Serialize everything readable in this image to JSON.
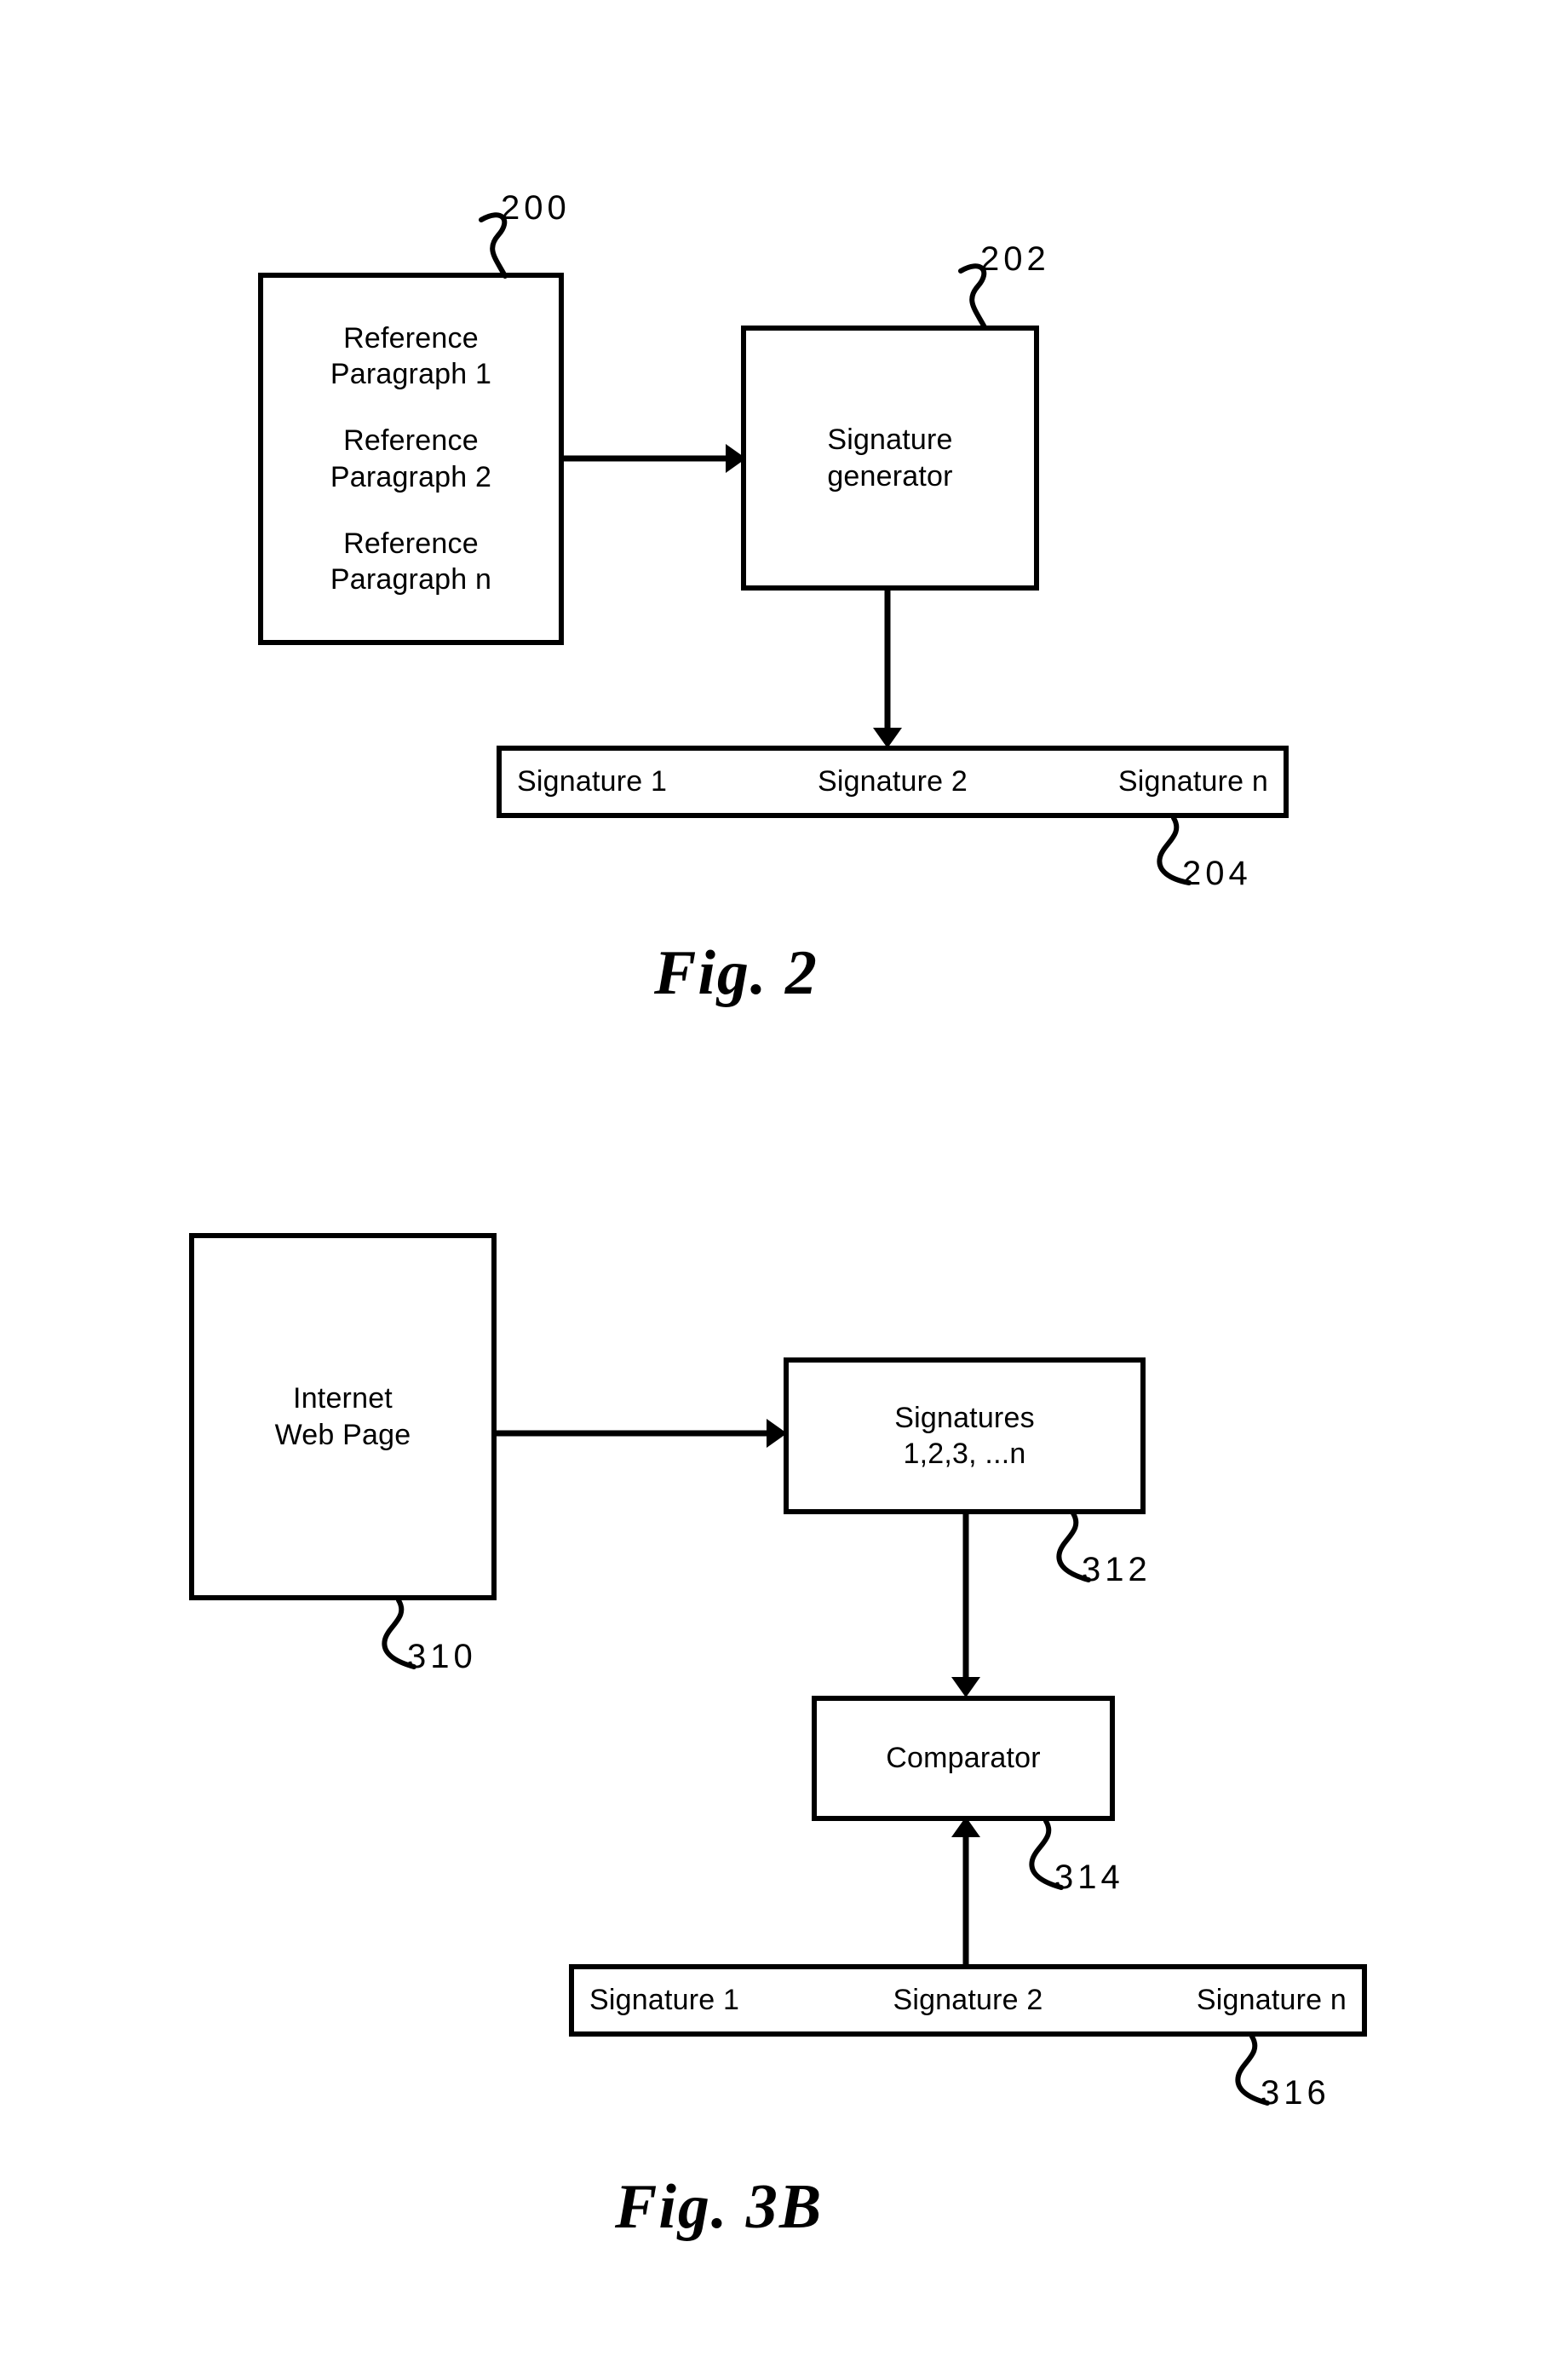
{
  "page": {
    "background_color": "#ffffff",
    "ink_color": "#000000",
    "kind": "patent-drawing-sheet"
  },
  "figures": [
    {
      "id": "fig2",
      "caption": "Fig.  2",
      "nodes": {
        "reference_paragraphs": {
          "ref": "200",
          "lines": [
            [
              "Reference",
              "Paragraph 1"
            ],
            [
              "Reference",
              "Paragraph 2"
            ],
            [
              "Reference",
              "Paragraph n"
            ]
          ]
        },
        "signature_generator": {
          "ref": "202",
          "lines": [
            "Signature",
            "generator"
          ]
        },
        "signature_store": {
          "ref": "204",
          "cells": [
            "Signature 1",
            "Signature 2",
            "Signature n"
          ]
        }
      }
    },
    {
      "id": "fig3b",
      "caption": "Fig.  3B",
      "nodes": {
        "internet_web_page": {
          "ref": "310",
          "lines": [
            "Internet",
            "Web Page"
          ]
        },
        "signatures_list": {
          "ref": "312",
          "lines": [
            "Signatures",
            "1,2,3, ...n"
          ]
        },
        "comparator": {
          "ref": "314",
          "lines": [
            "Comparator"
          ]
        },
        "reference_signature_store": {
          "ref": "316",
          "cells": [
            "Signature 1",
            "Signature 2",
            "Signature n"
          ]
        }
      }
    }
  ]
}
